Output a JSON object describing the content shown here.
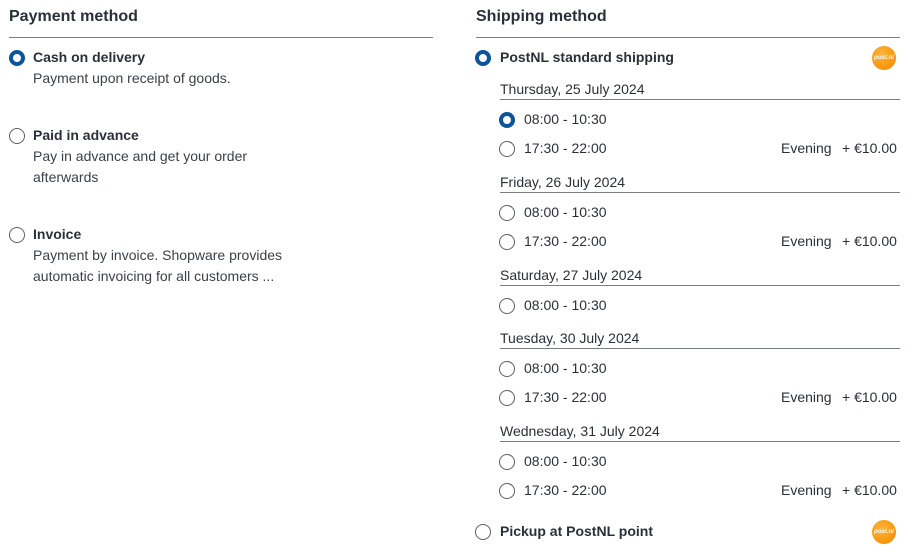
{
  "payment": {
    "title": "Payment method",
    "options": [
      {
        "label": "Cash on delivery",
        "description": "Payment upon receipt of goods.",
        "selected": true
      },
      {
        "label": "Paid in advance",
        "description": "Pay in advance and get your order afterwards",
        "selected": false
      },
      {
        "label": "Invoice",
        "description": "Payment by invoice. Shopware provides automatic invoicing for all customers ...",
        "selected": false
      }
    ]
  },
  "shipping": {
    "title": "Shipping method",
    "methods": [
      {
        "label": "PostNL standard shipping",
        "selected": true,
        "logo_text": "post.nl"
      },
      {
        "label": "Pickup at PostNL point",
        "selected": false,
        "logo_text": "post.nl"
      }
    ],
    "days": [
      {
        "label": "Thursday, 25 July 2024",
        "slots": [
          {
            "time": "08:00 - 10:30",
            "selected": true,
            "tag": "",
            "price": ""
          },
          {
            "time": "17:30 - 22:00",
            "selected": false,
            "tag": "Evening",
            "price": "+ €10.00"
          }
        ]
      },
      {
        "label": "Friday, 26 July 2024",
        "slots": [
          {
            "time": "08:00 - 10:30",
            "selected": false,
            "tag": "",
            "price": ""
          },
          {
            "time": "17:30 - 22:00",
            "selected": false,
            "tag": "Evening",
            "price": "+ €10.00"
          }
        ]
      },
      {
        "label": "Saturday, 27 July 2024",
        "slots": [
          {
            "time": "08:00 - 10:30",
            "selected": false,
            "tag": "",
            "price": ""
          }
        ]
      },
      {
        "label": "Tuesday, 30 July 2024",
        "slots": [
          {
            "time": "08:00 - 10:30",
            "selected": false,
            "tag": "",
            "price": ""
          },
          {
            "time": "17:30 - 22:00",
            "selected": false,
            "tag": "Evening",
            "price": "+ €10.00"
          }
        ]
      },
      {
        "label": "Wednesday, 31 July 2024",
        "slots": [
          {
            "time": "08:00 - 10:30",
            "selected": false,
            "tag": "",
            "price": ""
          },
          {
            "time": "17:30 - 22:00",
            "selected": false,
            "tag": "Evening",
            "price": "+ €10.00"
          }
        ]
      }
    ]
  },
  "colors": {
    "accent": "#0b539b",
    "logo": "#f7940c",
    "text": "#2a3039",
    "rule": "#7a7f87"
  }
}
